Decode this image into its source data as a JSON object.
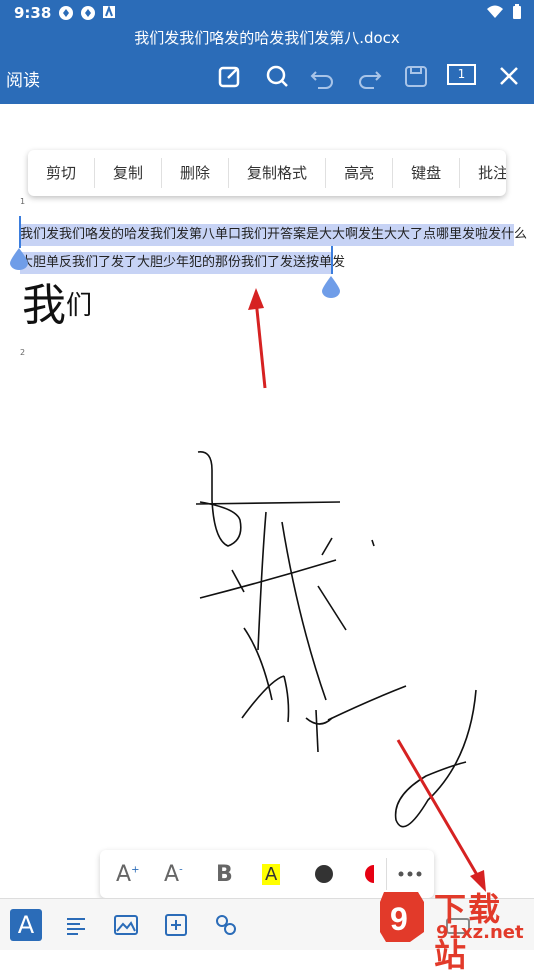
{
  "status": {
    "time": "9:38"
  },
  "title": "我们发我们咯发的哈发我们发第八.docx",
  "toolbar": {
    "read_label": "阅读",
    "page_count": "1"
  },
  "context_menu": [
    "剪切",
    "复制",
    "删除",
    "复制格式",
    "高亮",
    "键盘",
    "批注"
  ],
  "document": {
    "page1_num": "1",
    "line1": "我们发我们咯发的哈发我们发第八单口我们开答案是大大啊发生大大了点哪里发啦发什么",
    "line2": "大胆单反我们了发了大胆少年犯的那份我们了发送按单发",
    "big_text": "我",
    "big_text_small": "们",
    "page2_num": "2"
  },
  "format_bar": {
    "bold": "B",
    "highlight": "A",
    "grow": "A",
    "shrink": "A"
  },
  "bottom_bar": {
    "text_icon": "A"
  },
  "watermark": {
    "brand": "下载站",
    "site": "91xz.net"
  },
  "colors": {
    "accent": "#2b6cb8",
    "selection": "#c7d3f5",
    "highlight": "#ffff00",
    "red": "#e60012",
    "arrow": "#d62222"
  }
}
